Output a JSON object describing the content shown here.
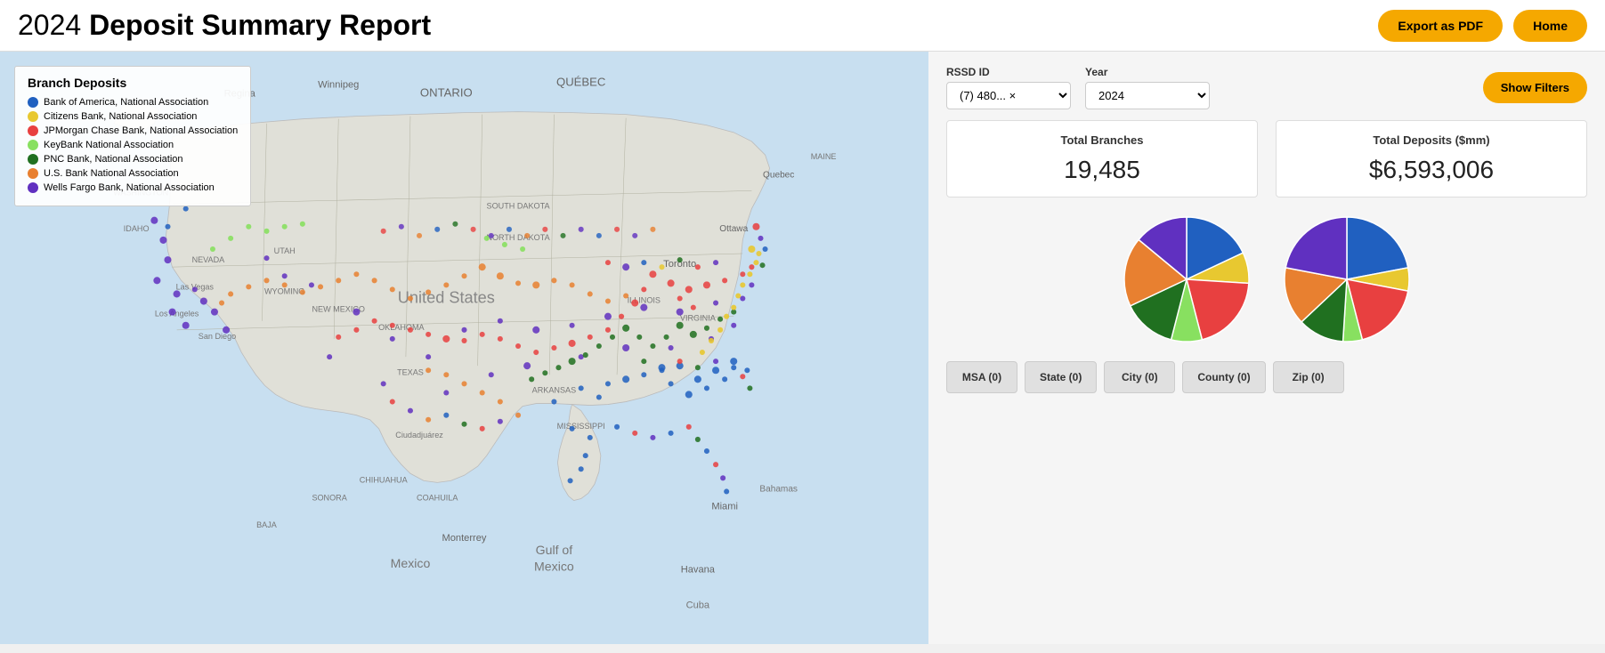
{
  "header": {
    "title_prefix": "2024 ",
    "title_main": "Deposit Summary Report",
    "export_btn": "Export as PDF",
    "home_btn": "Home"
  },
  "filters": {
    "rssd_label": "RSSD ID",
    "rssd_value": "(7) 480... ×",
    "year_label": "Year",
    "year_value": "2024",
    "show_filters_btn": "Show Filters"
  },
  "stats": {
    "branches_label": "Total Branches",
    "branches_value": "19,485",
    "deposits_label": "Total Deposits ($mm)",
    "deposits_value": "$6,593,006"
  },
  "legend": {
    "title": "Branch Deposits",
    "items": [
      {
        "name": "Bank of America, National Association",
        "color": "#2060c0"
      },
      {
        "name": "Citizens Bank, National Association",
        "color": "#e8c830"
      },
      {
        "name": "JPMorgan Chase Bank, National Association",
        "color": "#e84040"
      },
      {
        "name": "KeyBank National Association",
        "color": "#88e060"
      },
      {
        "name": "PNC Bank, National Association",
        "color": "#207020"
      },
      {
        "name": "U.S. Bank National Association",
        "color": "#e88030"
      },
      {
        "name": "Wells Fargo Bank, National Association",
        "color": "#6030c0"
      }
    ]
  },
  "filter_tabs": [
    {
      "label": "MSA (0)"
    },
    {
      "label": "State (0)"
    },
    {
      "label": "City (0)"
    },
    {
      "label": "County (0)"
    },
    {
      "label": "Zip (0)"
    }
  ],
  "pie_branches": {
    "slices": [
      {
        "color": "#2060c0",
        "value": 0.18
      },
      {
        "color": "#e8c830",
        "value": 0.08
      },
      {
        "color": "#e84040",
        "value": 0.2
      },
      {
        "color": "#88e060",
        "value": 0.08
      },
      {
        "color": "#207020",
        "value": 0.14
      },
      {
        "color": "#e88030",
        "value": 0.18
      },
      {
        "color": "#6030c0",
        "value": 0.14
      }
    ]
  },
  "pie_deposits": {
    "slices": [
      {
        "color": "#2060c0",
        "value": 0.22
      },
      {
        "color": "#e8c830",
        "value": 0.06
      },
      {
        "color": "#e84040",
        "value": 0.18
      },
      {
        "color": "#88e060",
        "value": 0.05
      },
      {
        "color": "#207020",
        "value": 0.12
      },
      {
        "color": "#e88030",
        "value": 0.15
      },
      {
        "color": "#6030c0",
        "value": 0.22
      }
    ]
  },
  "map": {
    "dots": []
  }
}
